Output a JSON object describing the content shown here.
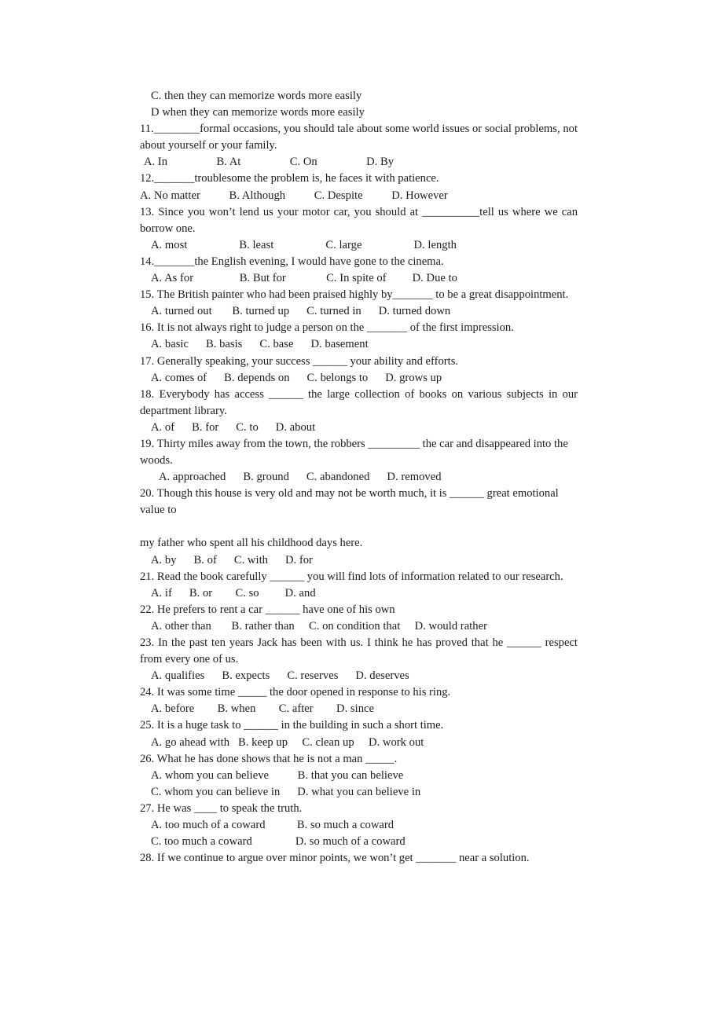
{
  "document": {
    "type": "scanned-exam-page",
    "subject": "English grammar multiple choice",
    "background_color": "#ffffff",
    "text_color": "#1c1c1c"
  },
  "carryover": {
    "option_c": "C. then they can memorize words more easily",
    "option_d": "D when they can memorize words more easily"
  },
  "questions": [
    {
      "number": "11",
      "stem": "11.________formal occasions, you should tale about some world issues or social problems, not about yourself or your family.",
      "options_line": "A. In                 B. At                 C. On                 D. By",
      "justified": true,
      "options_indent": "ind-xs"
    },
    {
      "number": "12",
      "stem": "12._______troublesome the problem is, he faces it with patience.",
      "options_line": "A. No matter          B. Although          C. Despite          D. However",
      "justified": false,
      "options_indent": "ind-0"
    },
    {
      "number": "13",
      "stem": "13. Since you won’t lend us your motor car, you should at __________tell us where we can borrow one.",
      "options_line": "A. most                  B. least                  C. large                  D. length",
      "justified": true,
      "options_indent": "ind-sm"
    },
    {
      "number": "14",
      "stem": "14._______the English evening, I would have gone to the cinema.",
      "options_line": "A. As for                B. But for              C. In spite of         D. Due to",
      "justified": false,
      "options_indent": "ind-sm"
    },
    {
      "number": "15",
      "stem": "15. The British painter who had been praised highly by_______ to be a great disappointment.",
      "options_line": "A. turned out       B. turned up      C. turned in      D. turned down",
      "justified": false,
      "options_indent": "ind-sm"
    },
    {
      "number": "16",
      "stem": "16. It is not always right to judge a person on the _______ of the first impression.",
      "options_line": "A. basic      B. basis      C. base      D. basement",
      "justified": false,
      "options_indent": "ind-sm"
    },
    {
      "number": "17",
      "stem": "17. Generally speaking, your success ______ your ability and efforts.",
      "options_line": "A. comes of      B. depends on      C. belongs to      D. grows up",
      "justified": false,
      "options_indent": "ind-sm"
    },
    {
      "number": "18",
      "stem": "18. Everybody has access ______ the large collection of books on various subjects in our department library.",
      "options_line": "A. of      B. for      C. to      D. about",
      "justified": true,
      "options_indent": "ind-sm"
    },
    {
      "number": "19",
      "stem": "19. Thirty miles away from the town, the robbers _________ the car and disappeared into the woods.",
      "options_line": "A. approached      B. ground      C. abandoned      D. removed",
      "justified": false,
      "options_indent": "ind-md"
    },
    {
      "number": "20",
      "stem": "20. Though this house is very old and may not be worth much, it is ______ great emotional value to",
      "stem_continued": "my father who spent all his childhood days here.",
      "options_line": "A. by      B. of      C. with      D. for",
      "justified": false,
      "options_indent": "ind-sm",
      "has_extra_gap": true
    },
    {
      "number": "21",
      "stem": "21. Read the book carefully ______ you will find lots of information related to our research.",
      "options_line": "A. if      B. or        C. so         D. and",
      "justified": false,
      "options_indent": "ind-sm"
    },
    {
      "number": "22",
      "stem": "22. He prefers to rent a car ______ have one of his own",
      "options_line": "A. other than       B. rather than     C. on condition that     D. would rather",
      "justified": false,
      "options_indent": "ind-sm"
    },
    {
      "number": "23",
      "stem": "23. In the past ten years Jack has been with us. I think he has proved that he ______ respect from every one of us.",
      "options_line": "A. qualifies      B. expects      C. reserves      D. deserves",
      "justified": true,
      "options_indent": "ind-sm"
    },
    {
      "number": "24",
      "stem": "24. It was some time _____ the door opened in response to his ring.",
      "options_line": "A. before        B. when        C. after        D. since",
      "justified": false,
      "options_indent": "ind-sm"
    },
    {
      "number": "25",
      "stem": "25. It is a huge task to ______ in the building in such a short time.",
      "options_line": "A. go ahead with   B. keep up     C. clean up     D. work out",
      "justified": false,
      "options_indent": "ind-sm"
    },
    {
      "number": "26",
      "stem": "26. What he has done shows that he is not a man _____.",
      "options_line": "A. whom you can believe          B. that you can believe",
      "options_line_2": "C. whom you can believe in      D. what you can believe in",
      "justified": false,
      "options_indent": "ind-sm"
    },
    {
      "number": "27",
      "stem": "27. He was ____ to speak the truth.",
      "options_line": "A. too much of a coward           B. so much a coward",
      "options_line_2": "C. too much a coward               D. so much of a coward",
      "justified": false,
      "options_indent": "ind-sm"
    },
    {
      "number": "28",
      "stem": "28. If we continue to argue over minor points, we won’t get _______ near a solution.",
      "justified": false,
      "options_indent": "ind-sm"
    }
  ]
}
